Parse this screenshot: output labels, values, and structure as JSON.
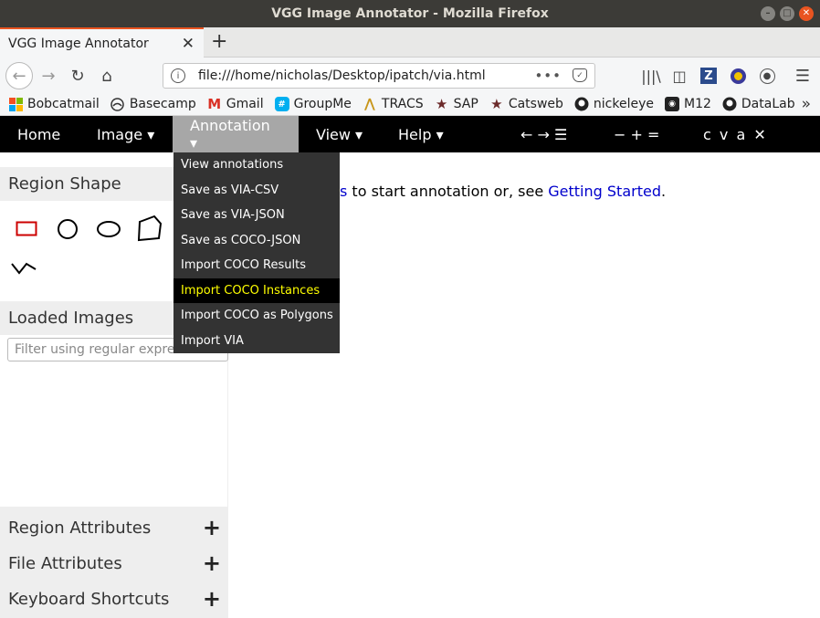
{
  "window": {
    "title": "VGG Image Annotator - Mozilla Firefox"
  },
  "tab": {
    "title": "VGG Image Annotator",
    "close": "✕",
    "new_tab": "+"
  },
  "address": {
    "url": "file:///home/nicholas/Desktop/ipatch/via.html",
    "more": "•••"
  },
  "bookmarks": [
    {
      "label": "Bobcatmail",
      "icon": "microsoft-icon"
    },
    {
      "label": "Basecamp",
      "icon": "basecamp-icon"
    },
    {
      "label": "Gmail",
      "icon": "gmail-icon"
    },
    {
      "label": "GroupMe",
      "icon": "groupme-icon"
    },
    {
      "label": "TRACS",
      "icon": "tracs-icon"
    },
    {
      "label": "SAP",
      "icon": "star-icon"
    },
    {
      "label": "Catsweb",
      "icon": "star-icon"
    },
    {
      "label": "nickeleye",
      "icon": "github-icon"
    },
    {
      "label": "M12",
      "icon": "m12-icon"
    },
    {
      "label": "DataLab",
      "icon": "github-icon"
    }
  ],
  "via_menu": {
    "home": "Home",
    "image": "Image ▾",
    "annotation": "Annotation ▾",
    "view": "View ▾",
    "help": "Help ▾",
    "nav_tools": "← → ☰",
    "zoom_tools": "− + =",
    "edit_tools": "c v a ✕"
  },
  "annotation_dropdown": [
    "View annotations",
    "Save as VIA-CSV",
    "Save as VIA-JSON",
    "Save as COCO-JSON",
    "Import COCO Results",
    "Import COCO Instances",
    "Import COCO as Polygons",
    "Import VIA"
  ],
  "highlighted_item": "Import COCO Instances",
  "left_panel": {
    "region_shape": "Region Shape",
    "loaded_images": "Loaded Images",
    "filter_placeholder": "Filter using regular expression",
    "region_attributes": "Region Attributes",
    "file_attributes": "File Attributes",
    "keyboard_shortcuts": "Keyboard Shortcuts",
    "plus": "+"
  },
  "main": {
    "partial_link": "s",
    "text": " to start annotation or, see ",
    "getting_started": "Getting Started",
    "end": "."
  },
  "colors": {
    "accent": "#e95420",
    "rect_shape": "#cc0000",
    "link": "#0000cc",
    "highlight": "#ffff00"
  }
}
